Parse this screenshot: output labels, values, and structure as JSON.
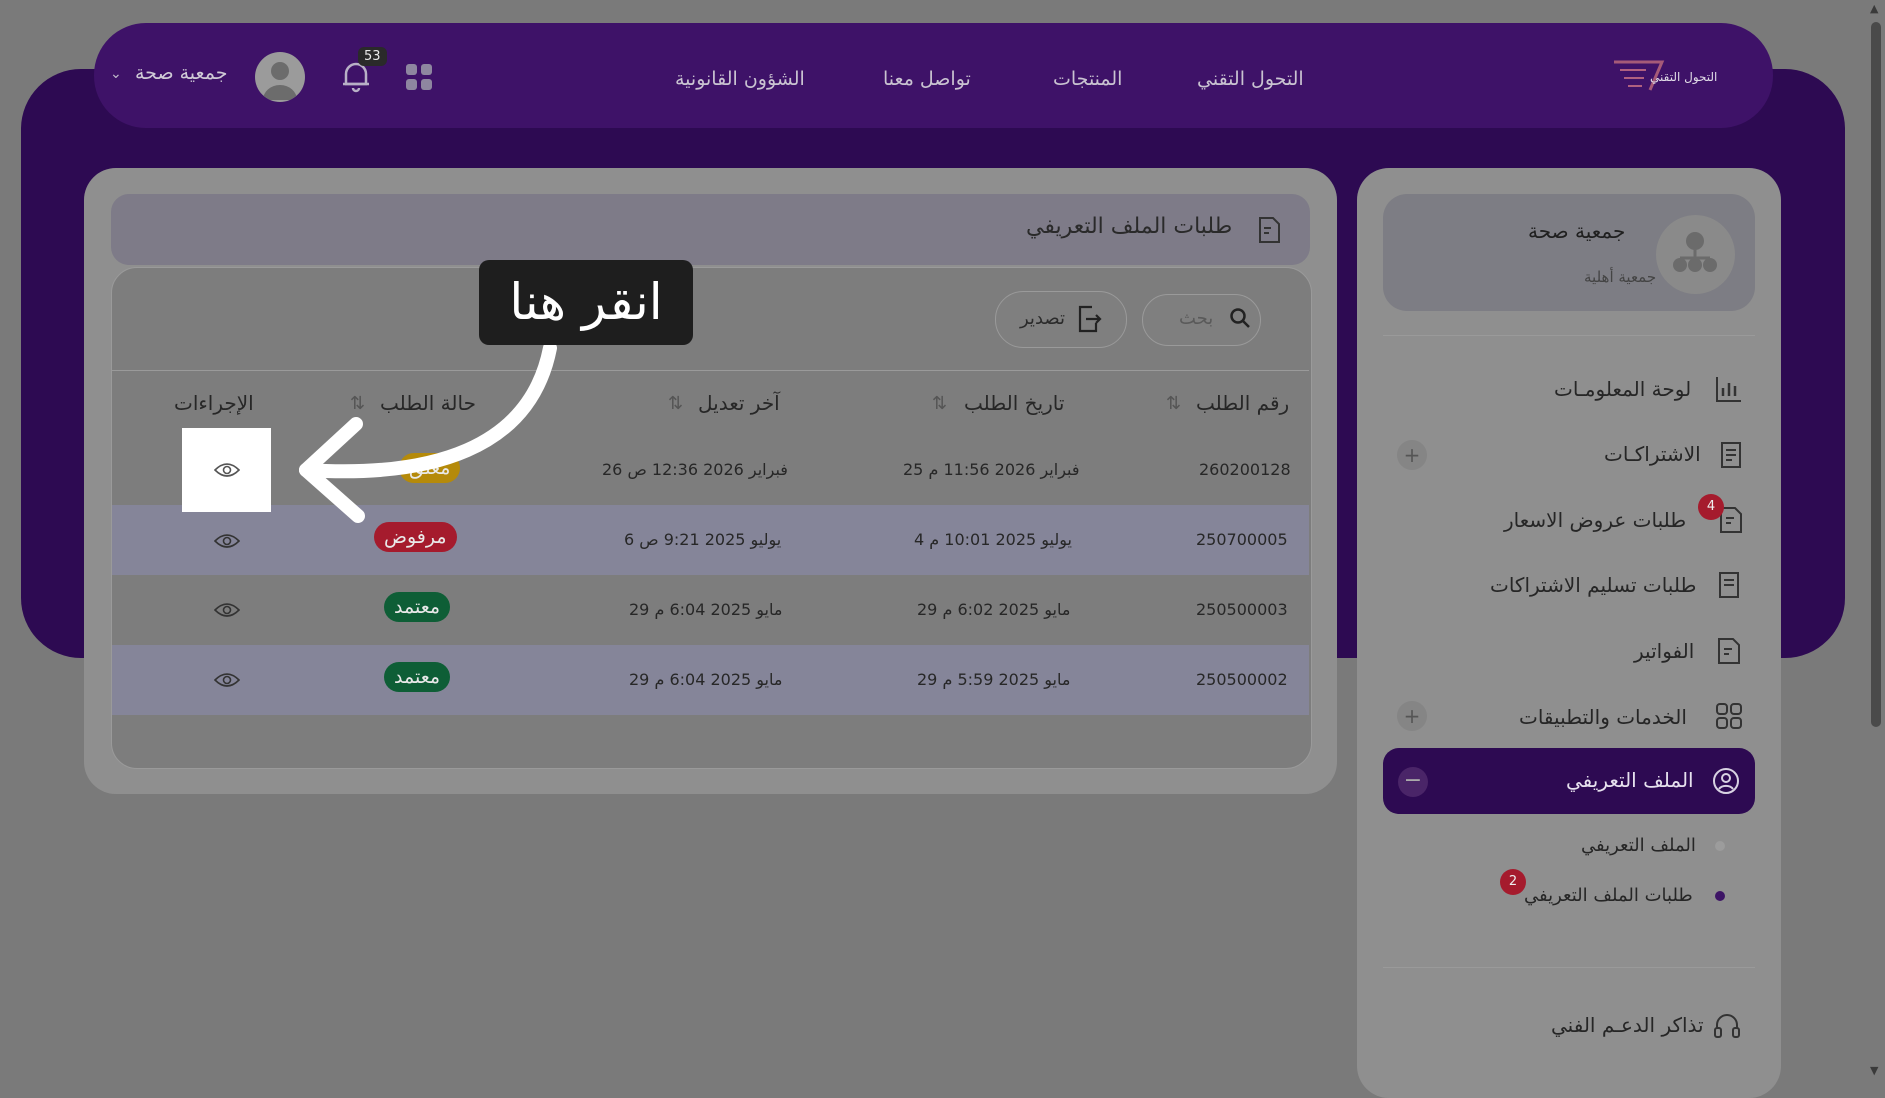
{
  "header": {
    "logo_text": "التحول التقني",
    "nav": [
      "التحول التقني",
      "المنتجات",
      "تواصل معنا",
      "الشؤون القانونية"
    ],
    "notification_count": "53",
    "user_name": "جمعية صحة"
  },
  "page": {
    "title": "طلبات الملف التعريفي",
    "search_placeholder": "بحث",
    "export_label": "تصدير"
  },
  "table": {
    "columns": [
      "رقم الطلب",
      "تاريخ الطلب",
      "آخر تعديل",
      "حالة الطلب",
      "الإجراءات"
    ],
    "rows": [
      {
        "id": "260200128",
        "date": "25 فبراير 2026 11:56 م",
        "modified": "26 فبراير 2026 12:36 ص",
        "status": "معلق"
      },
      {
        "id": "250700005",
        "date": "4 يوليو 2025 10:01 م",
        "modified": "6 يوليو 2025 9:21 ص",
        "status": "مرفوض"
      },
      {
        "id": "250500003",
        "date": "29 مايو 2025 6:02 م",
        "modified": "29 مايو 2025 6:04 م",
        "status": "معتمد"
      },
      {
        "id": "250500002",
        "date": "29 مايو 2025 5:59 م",
        "modified": "29 مايو 2025 6:04 م",
        "status": "معتمد"
      }
    ]
  },
  "sidebar": {
    "org_name": "جمعية صحة",
    "org_type": "جمعية أهلية",
    "items": [
      {
        "label": "لوحة المعلومـات"
      },
      {
        "label": "الاشتراكـات"
      },
      {
        "label": "طلبات عروض الاسعار",
        "badge": "4"
      },
      {
        "label": "طلبات تسليم الاشتراكات"
      },
      {
        "label": "الفواتير"
      },
      {
        "label": "الخدمات والتطبيقات"
      },
      {
        "label": "الملف التعريفي"
      }
    ],
    "sub_items": [
      {
        "label": "الملف التعريفي"
      },
      {
        "label": "طلبات الملف التعريفي",
        "badge": "2"
      }
    ],
    "support_label": "تذاكر الدعـم الفني"
  },
  "overlay": {
    "callout_text": "انقر هنا"
  },
  "colors": {
    "brand_purple": "#2d0a52",
    "approved": "#0e5e36",
    "rejected": "#a51b2d",
    "pending": "#b58a0a"
  }
}
